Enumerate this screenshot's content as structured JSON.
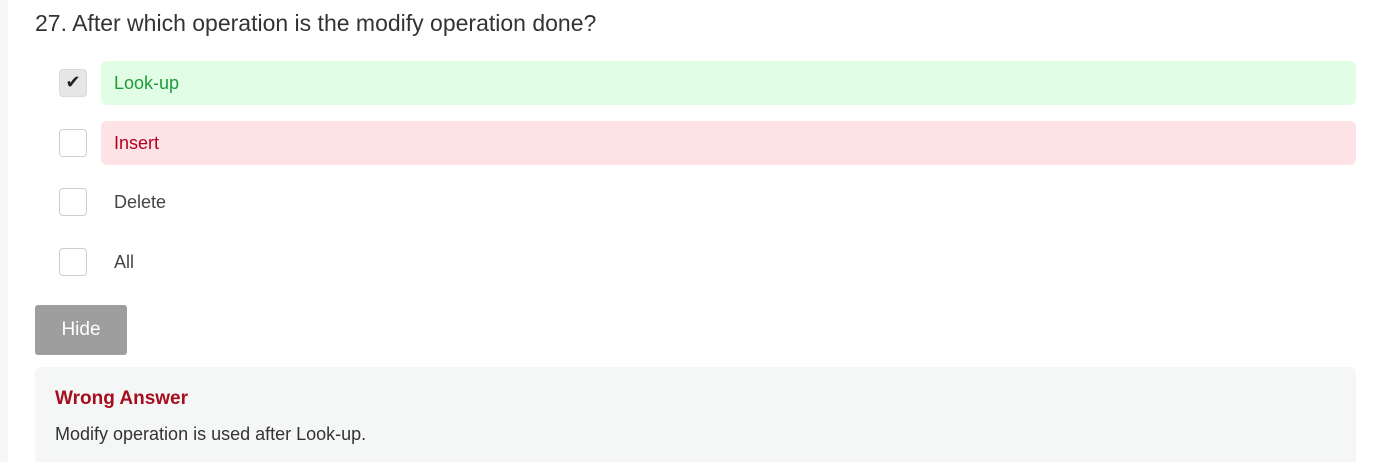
{
  "question": {
    "number": "27.",
    "text": "27. After which operation is the modify operation done?"
  },
  "options": [
    {
      "label": "Look-up",
      "checked": true,
      "state": "correct"
    },
    {
      "label": "Insert",
      "checked": false,
      "state": "wrong"
    },
    {
      "label": "Delete",
      "checked": false,
      "state": "plain"
    },
    {
      "label": "All",
      "checked": false,
      "state": "plain"
    }
  ],
  "hide_button": {
    "label": "Hide"
  },
  "feedback": {
    "title": "Wrong Answer",
    "text": "Modify operation is used after Look-up."
  },
  "icons": {
    "checkmark": "check-icon"
  },
  "colors": {
    "correct_bg": "#e2fde6",
    "correct_text": "#1f9a3c",
    "wrong_bg": "#fee3e6",
    "wrong_text": "#b00020",
    "feedback_title": "#a50e1f",
    "button_bg": "#9e9e9e"
  }
}
